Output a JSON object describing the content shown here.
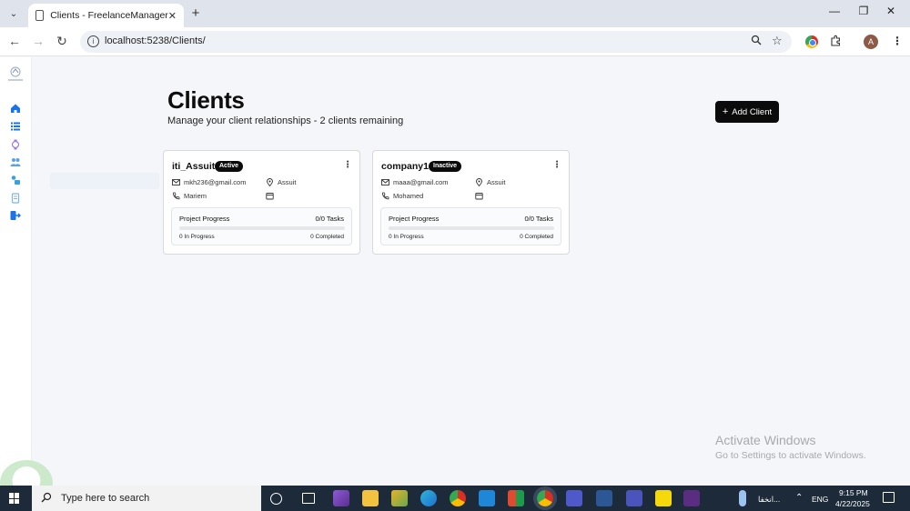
{
  "browser": {
    "tab_title": "Clients - FreelanceManager",
    "url": "localhost:5238/Clients/",
    "profile_initial": "A"
  },
  "page": {
    "title": "Clients",
    "subtitle": "Manage your client relationships - 2 clients remaining",
    "add_button_label": "Add Client"
  },
  "clients": [
    {
      "name": "iti_Assuit",
      "status": "Active",
      "email": "mkh236@gmail.com",
      "location": "Assuit",
      "contact": "Mariem",
      "progress_label": "Project Progress",
      "tasks": "0/0 Tasks",
      "progress": 0,
      "in_progress": "0 In Progress",
      "completed": "0 Completed"
    },
    {
      "name": "company1",
      "status": "Inactive",
      "email": "maaa@gmail.com",
      "location": "Assuit",
      "contact": "Mohamed",
      "progress_label": "Project Progress",
      "tasks": "0/0 Tasks",
      "progress": 0,
      "in_progress": "0 In Progress",
      "completed": "0 Completed"
    }
  ],
  "watermark": {
    "heading": "Activate Windows",
    "subtext": "Go to Settings to activate Windows."
  },
  "taskbar": {
    "search_placeholder": "Type here to search",
    "tray_app_label": "انخفا...",
    "language": "ENG",
    "time": "9:15 PM",
    "date": "4/22/2025"
  },
  "colors": {
    "primary": "#0b0b0b",
    "sidebar_icon": "#1a73e8",
    "page_bg": "#f5f6fa",
    "taskbar": "#1c2a3a"
  }
}
